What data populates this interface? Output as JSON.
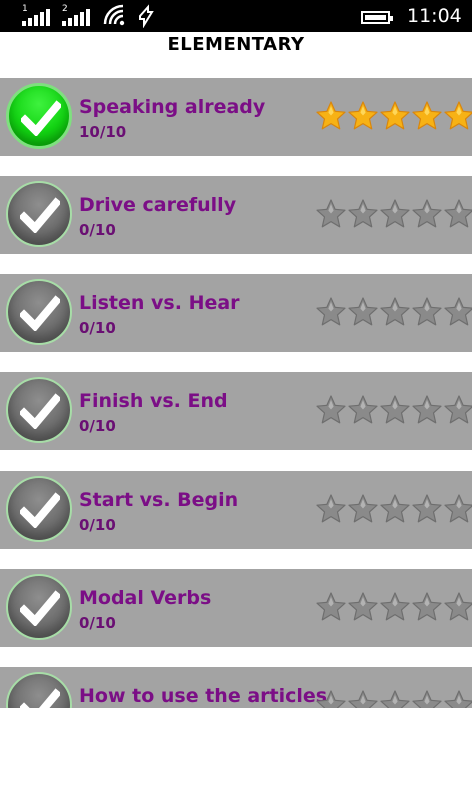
{
  "status_bar": {
    "sim1_label": "1",
    "sim2_label": "2",
    "time": "11:04"
  },
  "header": {
    "title": "ELEMENTARY"
  },
  "lessons": [
    {
      "title": "Speaking already",
      "score": "10/10",
      "completed": true,
      "stars": 5
    },
    {
      "title": "Drive carefully",
      "score": "0/10",
      "completed": false,
      "stars": 0
    },
    {
      "title": "Listen vs. Hear",
      "score": "0/10",
      "completed": false,
      "stars": 0
    },
    {
      "title": "Finish vs. End",
      "score": "0/10",
      "completed": false,
      "stars": 0
    },
    {
      "title": "Start vs. Begin",
      "score": "0/10",
      "completed": false,
      "stars": 0
    },
    {
      "title": "Modal Verbs",
      "score": "0/10",
      "completed": false,
      "stars": 0
    },
    {
      "title": "How to use the articles",
      "score": "",
      "completed": false,
      "stars": 0
    }
  ],
  "colors": {
    "title_purple": "#7b0e86",
    "row_gray": "#a3a3a3",
    "star_gold": "#f7b215",
    "star_gray": "#8a8a8a",
    "check_green": "#12d412"
  },
  "icons": {
    "row_check": "check-circle-icon",
    "rating": "star-icon"
  }
}
